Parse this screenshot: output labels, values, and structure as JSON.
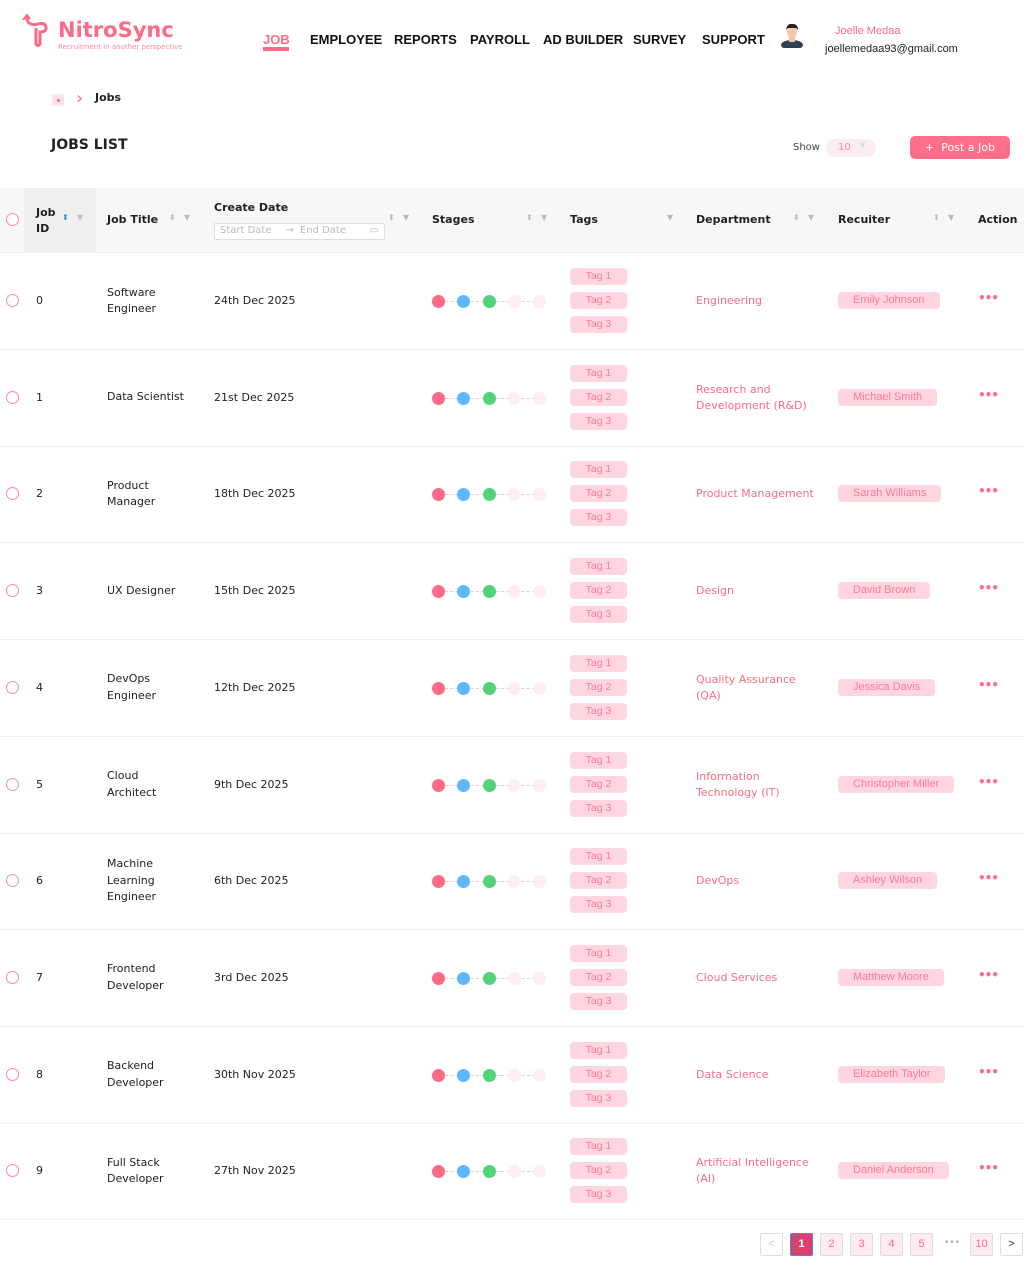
{
  "brand": {
    "name": "NitroSync",
    "tagline": "Recruitment in another perspective"
  },
  "nav": [
    "JOB",
    "EMPLOYEE",
    "REPORTS",
    "PAYROLL",
    "AD BUILDER",
    "SURVEY",
    "SUPPORT"
  ],
  "user": {
    "name": "Joelle Medaa",
    "email": "joellemedaa93@gmail.com"
  },
  "breadcrumb": {
    "current": "Jobs"
  },
  "page_title": "JOBS LIST",
  "show": {
    "label": "Show",
    "value": "10"
  },
  "post_button": "Post a Job",
  "columns": {
    "id": "Job ID",
    "title": "Job Title",
    "date": "Create Date",
    "stages": "Stages",
    "tags": "Tags",
    "dept": "Department",
    "recruiter": "Recuiter",
    "action": "Action"
  },
  "date_filter": {
    "start": "Start Date",
    "end": "End Date"
  },
  "colors": {
    "accent": "#ff6b86",
    "stage1": "#ff6b86",
    "stage2": "#5cb8ff",
    "stage3": "#52d37a",
    "stage_off": "#fdeef2"
  },
  "rows": [
    {
      "id": "0",
      "title": "Software Engineer",
      "date": "24th Dec 2025",
      "tags": [
        "Tag 1",
        "Tag 2",
        "Tag 3"
      ],
      "dept": "Engineering",
      "recruiter": "Emily Johnson"
    },
    {
      "id": "1",
      "title": "Data Scientist",
      "date": "21st Dec 2025",
      "tags": [
        "Tag 1",
        "Tag 2",
        "Tag 3"
      ],
      "dept": "Research and Development (R&D)",
      "recruiter": "Michael Smith"
    },
    {
      "id": "2",
      "title": "Product Manager",
      "date": "18th Dec 2025",
      "tags": [
        "Tag 1",
        "Tag 2",
        "Tag 3"
      ],
      "dept": "Product Management",
      "recruiter": "Sarah Williams"
    },
    {
      "id": "3",
      "title": "UX Designer",
      "date": "15th Dec 2025",
      "tags": [
        "Tag 1",
        "Tag 2",
        "Tag 3"
      ],
      "dept": "Design",
      "recruiter": "David Brown"
    },
    {
      "id": "4",
      "title": "DevOps Engineer",
      "date": "12th Dec 2025",
      "tags": [
        "Tag 1",
        "Tag 2",
        "Tag 3"
      ],
      "dept": "Quality Assurance (QA)",
      "recruiter": "Jessica Davis"
    },
    {
      "id": "5",
      "title": "Cloud Architect",
      "date": "9th Dec 2025",
      "tags": [
        "Tag 1",
        "Tag 2",
        "Tag 3"
      ],
      "dept": "Information Technology (IT)",
      "recruiter": "Christopher Miller"
    },
    {
      "id": "6",
      "title": "Machine Learning Engineer",
      "date": "6th Dec 2025",
      "tags": [
        "Tag 1",
        "Tag 2",
        "Tag 3"
      ],
      "dept": "DevOps",
      "recruiter": "Ashley Wilson"
    },
    {
      "id": "7",
      "title": "Frontend Developer",
      "date": "3rd Dec 2025",
      "tags": [
        "Tag 1",
        "Tag 2",
        "Tag 3"
      ],
      "dept": "Cloud Services",
      "recruiter": "Matthew Moore"
    },
    {
      "id": "8",
      "title": "Backend Developer",
      "date": "30th Nov 2025",
      "tags": [
        "Tag 1",
        "Tag 2",
        "Tag 3"
      ],
      "dept": "Data Science",
      "recruiter": "Elizabeth Taylor"
    },
    {
      "id": "9",
      "title": "Full Stack Developer",
      "date": "27th Nov 2025",
      "tags": [
        "Tag 1",
        "Tag 2",
        "Tag 3"
      ],
      "dept": "Artificial Intelligence (AI)",
      "recruiter": "Daniel Anderson"
    }
  ],
  "pagination": {
    "pages": [
      "1",
      "2",
      "3",
      "4",
      "5",
      "10"
    ],
    "current": "1",
    "ellipsis": "•••",
    "prev": "<",
    "next": ">"
  }
}
